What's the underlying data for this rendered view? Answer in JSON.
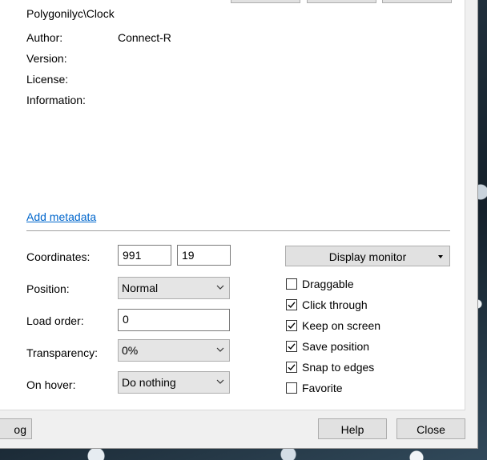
{
  "header": {
    "skin_path": "Polygonilyc\\Clock"
  },
  "metadata": {
    "author_label": "Author:",
    "author_value": "Connect-R",
    "version_label": "Version:",
    "license_label": "License:",
    "information_label": "Information:",
    "add_metadata_link": "Add metadata"
  },
  "settings": {
    "coordinates_label": "Coordinates:",
    "coord_x": "991",
    "coord_y": "19",
    "position_label": "Position:",
    "position_value": "Normal",
    "load_order_label": "Load order:",
    "load_order_value": "0",
    "transparency_label": "Transparency:",
    "transparency_value": "0%",
    "on_hover_label": "On hover:",
    "on_hover_value": "Do nothing",
    "display_monitor_label": "Display monitor"
  },
  "options": [
    {
      "label": "Draggable",
      "checked": false
    },
    {
      "label": "Click through",
      "checked": true
    },
    {
      "label": "Keep on screen",
      "checked": true
    },
    {
      "label": "Save position",
      "checked": true
    },
    {
      "label": "Snap to edges",
      "checked": true
    },
    {
      "label": "Favorite",
      "checked": false
    }
  ],
  "footer": {
    "log_button": "og",
    "help_button": "Help",
    "close_button": "Close"
  }
}
